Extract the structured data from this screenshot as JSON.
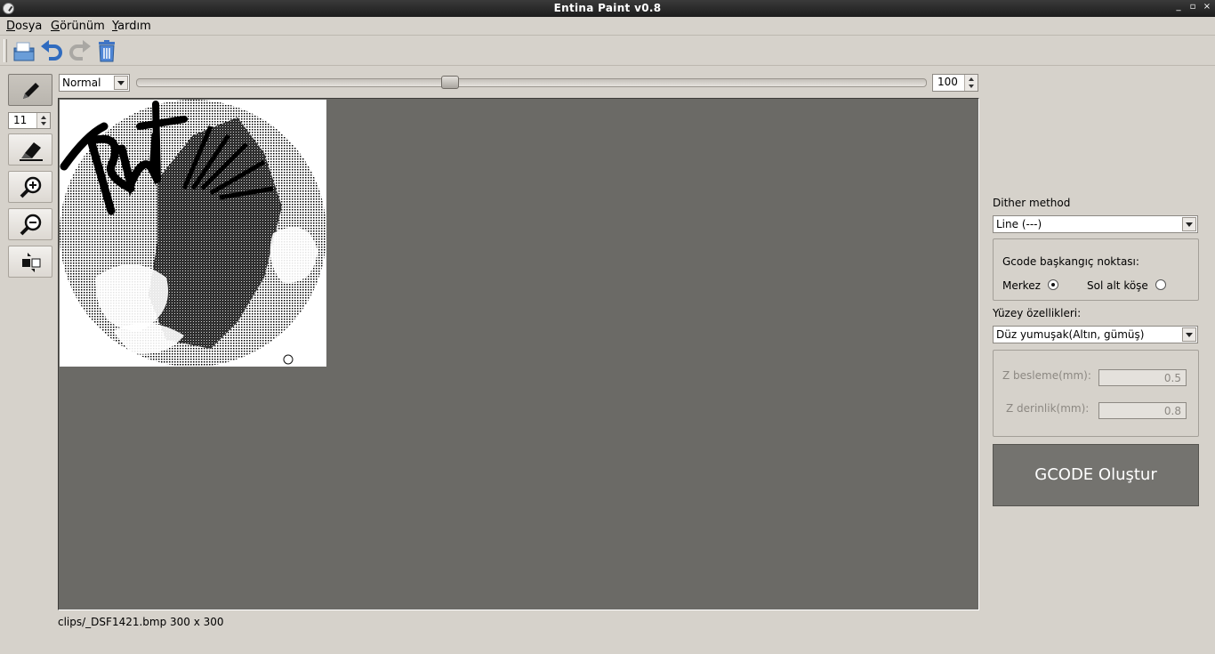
{
  "window": {
    "title": "Entina Paint v0.8",
    "controls": [
      "_",
      "▫",
      "×"
    ]
  },
  "menu": {
    "items": [
      "Dosya",
      "Görünüm",
      "Yardım"
    ]
  },
  "toolbar": {
    "icons": [
      "open-file-icon",
      "undo-icon",
      "redo-icon",
      "trash-icon"
    ]
  },
  "tools": {
    "brush_size": "11",
    "items": [
      "pencil-icon",
      "eraser-icon",
      "zoom-in-icon",
      "zoom-out-icon",
      "transform-icon"
    ],
    "active": "pencil-icon"
  },
  "top_controls": {
    "blend_mode": "Normal",
    "slider_value": 0.4,
    "opacity_value": "100"
  },
  "status": {
    "text": "clips/_DSF1421.bmp 300 x 300"
  },
  "right_panel": {
    "dither_label": "Dither method",
    "dither_value": "Line (---)",
    "origin_group_label": "Gcode başkangıç noktası:",
    "origin_center": "Merkez",
    "origin_bottom_left": "Sol alt köşe",
    "origin_selected": "Merkez",
    "surface_label": "Yüzey özellikleri:",
    "surface_value": "Düz yumuşak(Altın, gümüş)",
    "z_feed_label": "Z besleme(mm):",
    "z_feed_value": "0.5",
    "z_depth_label": "Z derinlik(mm):",
    "z_depth_value": "0.8",
    "generate_button": "GCODE Oluştur"
  }
}
